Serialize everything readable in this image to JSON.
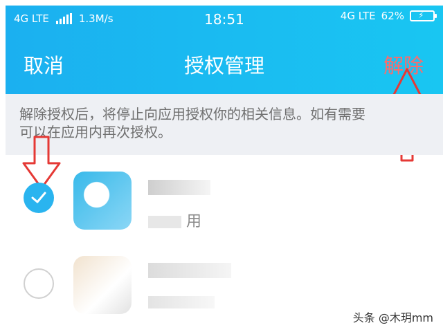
{
  "status_bar": {
    "network": "4G LTE",
    "speed": "1.3M/s",
    "time": "18:51",
    "network_right": "4G LTE",
    "battery": "62%"
  },
  "nav": {
    "cancel": "取消",
    "title": "授权管理",
    "remove": "解除"
  },
  "notice": {
    "line1": "解除授权后，将停止向应用授权你的相关信息。如有需要",
    "line2": "可以在应用内再次授权。"
  },
  "apps": [
    {
      "selected": true,
      "line2": "用"
    },
    {
      "selected": false
    }
  ],
  "watermark": "头条 @木玥mm",
  "colors": {
    "header_start": "#1bb0f0",
    "header_end": "#19c6f2",
    "remove_text": "#ff6a6a",
    "check_blue": "#2ab4ef",
    "arrow_red": "#e53935"
  }
}
